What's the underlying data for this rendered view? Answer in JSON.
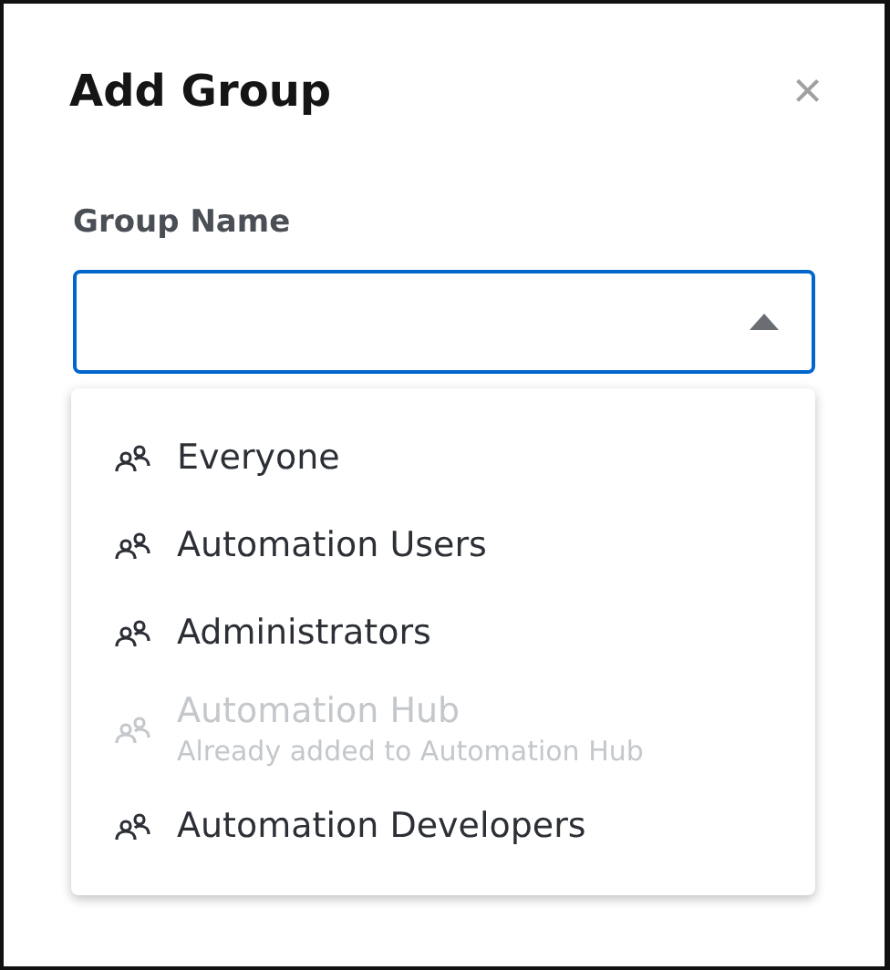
{
  "dialog": {
    "title": "Add Group",
    "close": "×"
  },
  "field": {
    "label": "Group Name",
    "expanded": true
  },
  "options": [
    {
      "label": "Everyone",
      "disabled": false
    },
    {
      "label": "Automation Users",
      "disabled": false
    },
    {
      "label": "Administrators",
      "disabled": false
    },
    {
      "label": "Automation Hub",
      "note": "Already added to Automation Hub",
      "disabled": true
    },
    {
      "label": "Automation Developers",
      "disabled": false
    }
  ]
}
